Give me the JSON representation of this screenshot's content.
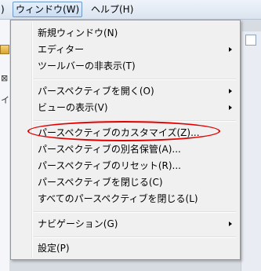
{
  "menubar": {
    "prev_label": ")",
    "window_label": "ウィンドウ(W)",
    "help_label": "ヘルプ(H)"
  },
  "left_strip": {
    "close_glyph": "⊠",
    "char": "イ"
  },
  "menu": {
    "items": [
      {
        "label": "新規ウィンドウ(N)",
        "submenu": false
      },
      {
        "label": "エディター",
        "submenu": true
      },
      {
        "label": "ツールバーの非表示(T)",
        "submenu": false
      },
      {
        "label": "パースペクティブを開く(O)",
        "submenu": true
      },
      {
        "label": "ビューの表示(V)",
        "submenu": true
      },
      {
        "label": "パースペクティブのカスタマイズ(Z)...",
        "submenu": false,
        "highlighted": true
      },
      {
        "label": "パースペクティブの別名保管(A)...",
        "submenu": false
      },
      {
        "label": "パースペクティブのリセット(R)...",
        "submenu": false
      },
      {
        "label": "パースペクティブを閉じる(C)",
        "submenu": false
      },
      {
        "label": "すべてのパースペクティブを閉じる(L)",
        "submenu": false
      },
      {
        "label": "ナビゲーション(G)",
        "submenu": true
      },
      {
        "label": "設定(P)",
        "submenu": false
      }
    ]
  },
  "colors": {
    "highlight_outline": "#e10000",
    "menu_bg": "#f0f0f0"
  }
}
